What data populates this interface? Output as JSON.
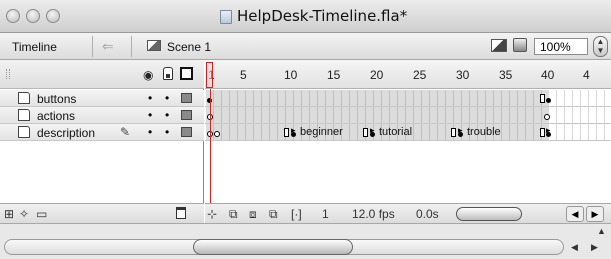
{
  "window": {
    "title": "HelpDesk-Timeline.fla*",
    "doc_icon": "document-icon"
  },
  "toolbar": {
    "timeline_label": "Timeline",
    "back_icon": "back-arrow-icon",
    "scene_label": "Scene 1",
    "zoom_value": "100%",
    "zoom_stepper_icon": "up-down-stepper-icon"
  },
  "layers": {
    "header_icons": [
      "eye-icon",
      "lock-icon",
      "outline-icon"
    ],
    "items": [
      {
        "name": "buttons",
        "visible": "•",
        "locked": "•"
      },
      {
        "name": "actions",
        "visible": "•",
        "locked": "•"
      },
      {
        "name": "description",
        "visible": "•",
        "locked": "•",
        "editing": "pencil-icon"
      }
    ]
  },
  "ruler": {
    "numbers": [
      "1",
      "5",
      "10",
      "15",
      "20",
      "25",
      "30",
      "35",
      "40",
      "4"
    ]
  },
  "frame_labels": {
    "beginner": "beginner",
    "tutorial": "tutorial",
    "trouble": "trouble"
  },
  "frame_footer": {
    "current_frame": "1",
    "frame_rate": "12.0 fps",
    "elapsed_time": "0.0s"
  },
  "colors": {
    "playhead": "#c62828",
    "layer_color_swatch": "#8a8a8a"
  }
}
